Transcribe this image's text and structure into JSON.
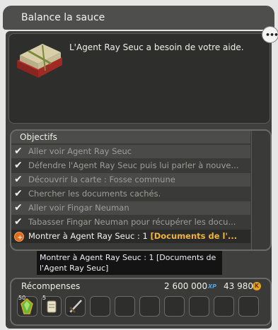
{
  "window": {
    "title": "Balance la sauce"
  },
  "chat_icon": {
    "icon": "chat-bubble-icon",
    "glyph": "•••"
  },
  "intro": {
    "text": "L'Agent Ray Seuc a besoin de votre aide.",
    "icon": "quest-book-icon"
  },
  "objectives": {
    "header": "Objectifs",
    "items": [
      {
        "text": "Aller voir Agent Ray Seuc",
        "done": true
      },
      {
        "text": "Défendre l'Agent Ray Seuc puis lui parler à nouve...",
        "done": true
      },
      {
        "text": "Découvrir la carte : Fosse commune",
        "done": true
      },
      {
        "text": "Chercher les documents cachés.",
        "done": true
      },
      {
        "text": "Aller voir Fingar Neuman",
        "done": true
      },
      {
        "text": "Tabasser Fingar Neuman pour récupérer les docu...",
        "done": true
      }
    ],
    "current": {
      "text_prefix": "Montrer à Agent Ray Seuc : 1 ",
      "text_highlight": "[Documents de l'...",
      "icon": "quest-progress-icon"
    }
  },
  "tooltip": {
    "line1": "Montrer à Agent Ray Seuc : 1 [Documents de",
    "line2": "l'Agent Ray Seuc]"
  },
  "rewards": {
    "label": "Récompenses",
    "xp_value": "2 600 000",
    "xp_tag": "XP",
    "kamas_value": "43 980",
    "kamas_tag": "K",
    "slots": [
      {
        "qty": "50",
        "icon": "green-crystal-icon"
      },
      {
        "qty": "5",
        "icon": "scroll-icon"
      },
      {
        "qty": "",
        "icon": "sword-icon"
      },
      {
        "qty": "",
        "icon": ""
      },
      {
        "qty": "",
        "icon": ""
      },
      {
        "qty": "",
        "icon": ""
      },
      {
        "qty": "",
        "icon": ""
      },
      {
        "qty": "",
        "icon": ""
      },
      {
        "qty": "",
        "icon": ""
      },
      {
        "qty": "",
        "icon": ""
      }
    ]
  },
  "colors": {
    "accent": "#f0b43c",
    "panel": "#3f3f3d",
    "xp": "#4aa8e8",
    "kamas": "#e8a020"
  }
}
